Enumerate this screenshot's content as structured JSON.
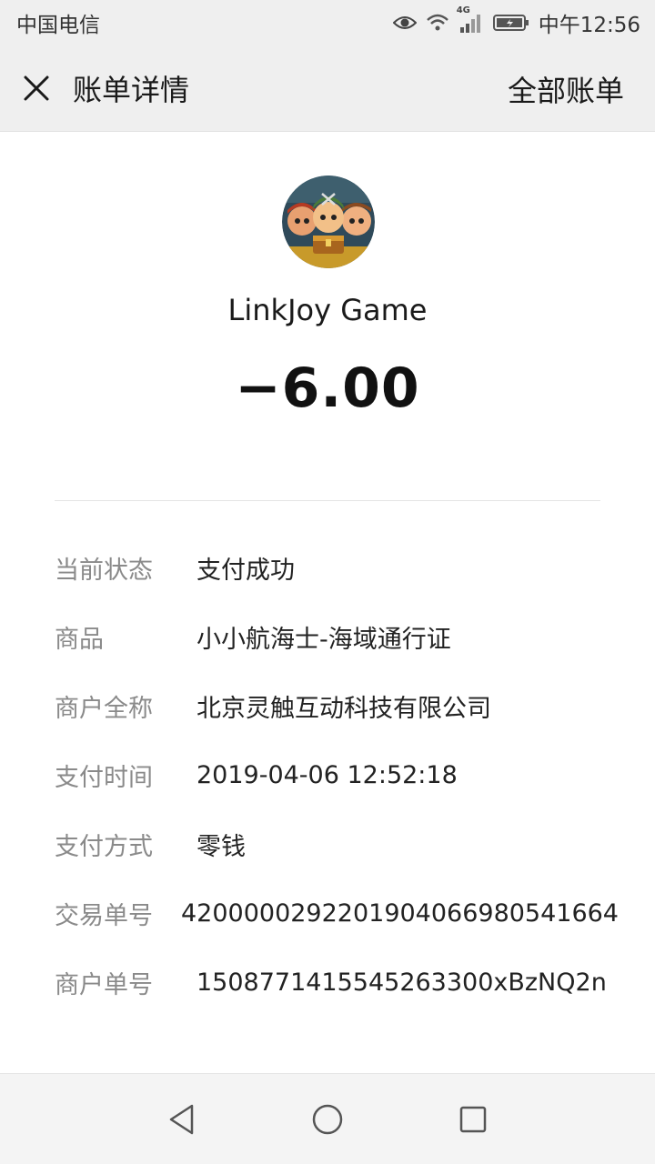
{
  "status_bar": {
    "carrier": "中国电信",
    "network": "4G",
    "time": "中午12:56"
  },
  "header": {
    "title": "账单详情",
    "right_action": "全部账单",
    "close_icon": "close-icon"
  },
  "merchant": {
    "name": "LinkJoy Game",
    "amount": "−6.00"
  },
  "details": [
    {
      "label": "当前状态",
      "value": "支付成功"
    },
    {
      "label": "商品",
      "value": "小小航海士-海域通行证"
    },
    {
      "label": "商户全称",
      "value": "北京灵触互动科技有限公司"
    },
    {
      "label": "支付时间",
      "value": "2019-04-06 12:52:18"
    },
    {
      "label": "支付方式",
      "value": "零钱"
    },
    {
      "label": "交易单号",
      "value": "4200000292201904066980541664"
    },
    {
      "label": "商户单号",
      "value": "1508771415545263300xBzNQ2n"
    }
  ],
  "nav": {
    "back_icon": "back-triangle-icon",
    "home_icon": "home-circle-icon",
    "recent_icon": "recent-square-icon"
  }
}
